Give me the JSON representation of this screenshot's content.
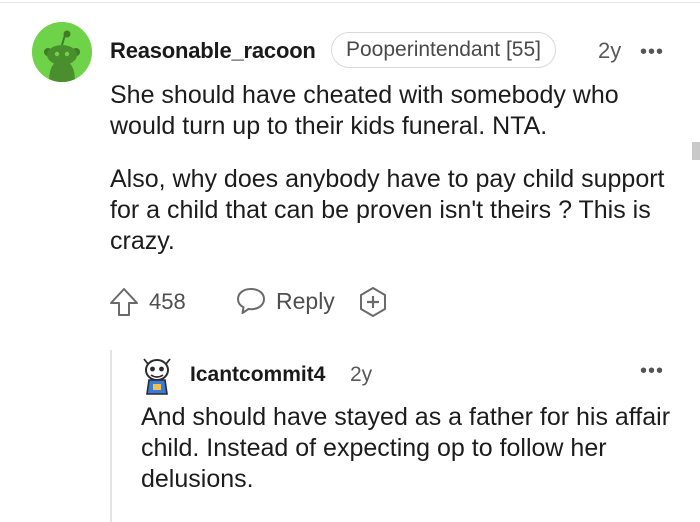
{
  "comment": {
    "author": "Reasonable_racoon",
    "flair": "Pooperintendant [55]",
    "time": "2y",
    "more": "•••",
    "paragraphs": [
      "She should have cheated with somebody who would turn up to their kids funeral. NTA.",
      "Also, why does anybody have to pay child support for a child that can be proven isn't theirs ? This is crazy."
    ],
    "score": "458",
    "reply_label": "Reply"
  },
  "reply": {
    "author": "Icantcommit4",
    "time": "2y",
    "more": "•••",
    "text": "And should have stayed as a father for his affair child. Instead of expecting op to follow her delusions."
  },
  "colors": {
    "avatar_bg": "#6fd34a",
    "text": "#1c1c1c",
    "meta": "#595959"
  },
  "icons": [
    "reddit-snoo-avatar-icon",
    "upvote-arrow-icon",
    "reply-bubble-icon",
    "award-plus-icon",
    "child-avatar-icon",
    "more-options-icon"
  ]
}
